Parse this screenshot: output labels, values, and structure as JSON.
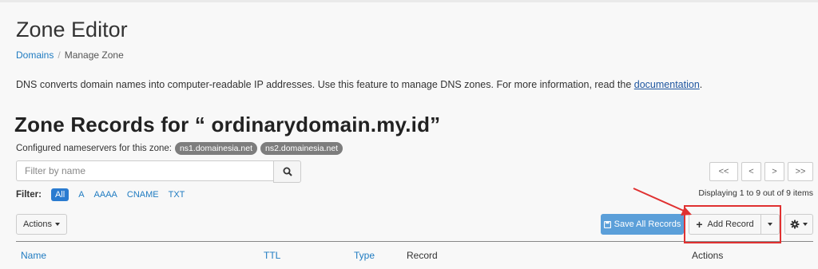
{
  "page_title": "Zone Editor",
  "breadcrumb": {
    "root": "Domains",
    "separator": "/",
    "current": "Manage Zone"
  },
  "intro": {
    "text": "DNS converts domain names into computer-readable IP addresses. Use this feature to manage DNS zones. For more information, read the ",
    "link": "documentation",
    "end": "."
  },
  "zone": {
    "heading": "Zone Records for “ ordinarydomain.my.id”",
    "ns_label": "Configured nameservers for this zone:",
    "nameservers": [
      "ns1.domainesia.net",
      "ns2.domainesia.net"
    ]
  },
  "search": {
    "placeholder": "Filter by name",
    "value": ""
  },
  "filter": {
    "label": "Filter:",
    "options": [
      "All",
      "A",
      "AAAA",
      "CNAME",
      "TXT"
    ],
    "active": "All"
  },
  "pager": {
    "first": "<<",
    "prev": "<",
    "next": ">",
    "last": ">>",
    "displaying": "Displaying 1 to 9 out of 9 items"
  },
  "toolbar": {
    "actions_label": "Actions",
    "save_all": "Save All Records",
    "add_record": "Add Record"
  },
  "table": {
    "columns": [
      "Name",
      "TTL",
      "Type",
      "Record",
      "Actions"
    ]
  },
  "colors": {
    "link": "#1f7bc1",
    "primary": "#5b9fd9",
    "annotation": "#e03131"
  }
}
